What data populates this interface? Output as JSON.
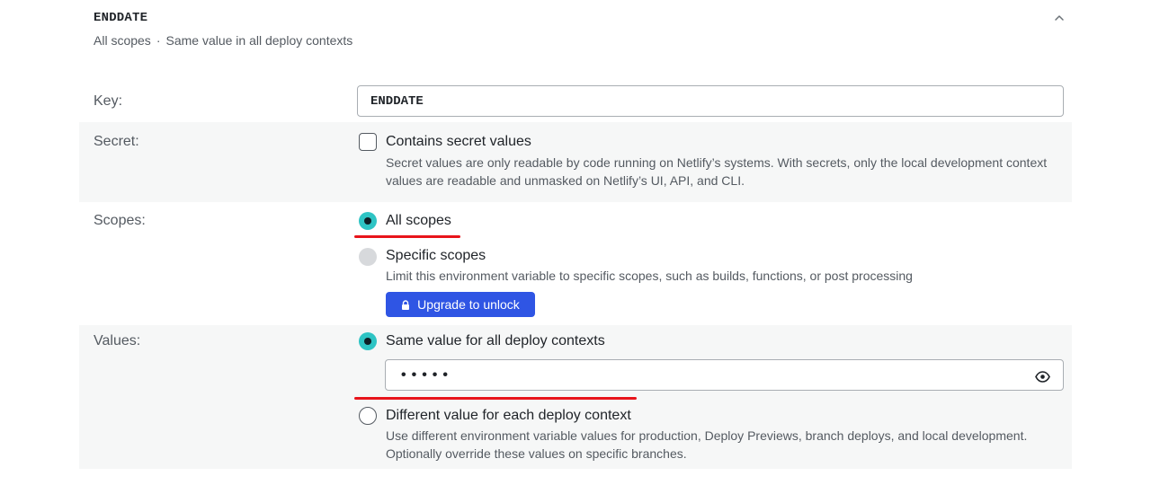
{
  "header": {
    "title": "ENDDATE",
    "scope_text": "All scopes",
    "separator": "·",
    "context_text": "Same value in all deploy contexts",
    "collapse_icon": "chevron-up-icon"
  },
  "key": {
    "label": "Key:",
    "value": "ENDDATE"
  },
  "secret": {
    "label": "Secret:",
    "checkbox_label": "Contains secret values",
    "checked": false,
    "description_line1": "Secret values are only readable by code running on Netlify’s systems. With secrets, only the local development context",
    "description_line2": "values are readable and unmasked on Netlify’s UI, API, and CLI."
  },
  "scopes": {
    "label": "Scopes:",
    "options": [
      {
        "label": "All scopes",
        "checked": true
      },
      {
        "label": "Specific scopes",
        "checked": false,
        "disabled": true,
        "description": "Limit this environment variable to specific scopes, such as builds, functions, or post processing"
      }
    ],
    "upgrade_label": "Upgrade to unlock",
    "upgrade_icon": "lock-icon"
  },
  "values": {
    "label": "Values:",
    "options": [
      {
        "label": "Same value for all deploy contexts",
        "checked": true
      },
      {
        "label": "Different value for each deploy context",
        "checked": false,
        "description_line1": "Use different environment variable values for production, Deploy Previews, branch deploys, and local development.",
        "description_line2": "Optionally override these values on specific branches."
      }
    ],
    "masked_value": "•••••",
    "reveal_icon": "eye-icon"
  },
  "colors": {
    "accent_radio": "#2ec4c4",
    "upgrade_button": "#2f55e4",
    "annotation_underline": "#e8141b",
    "alt_row_bg": "#f6f7f7"
  }
}
